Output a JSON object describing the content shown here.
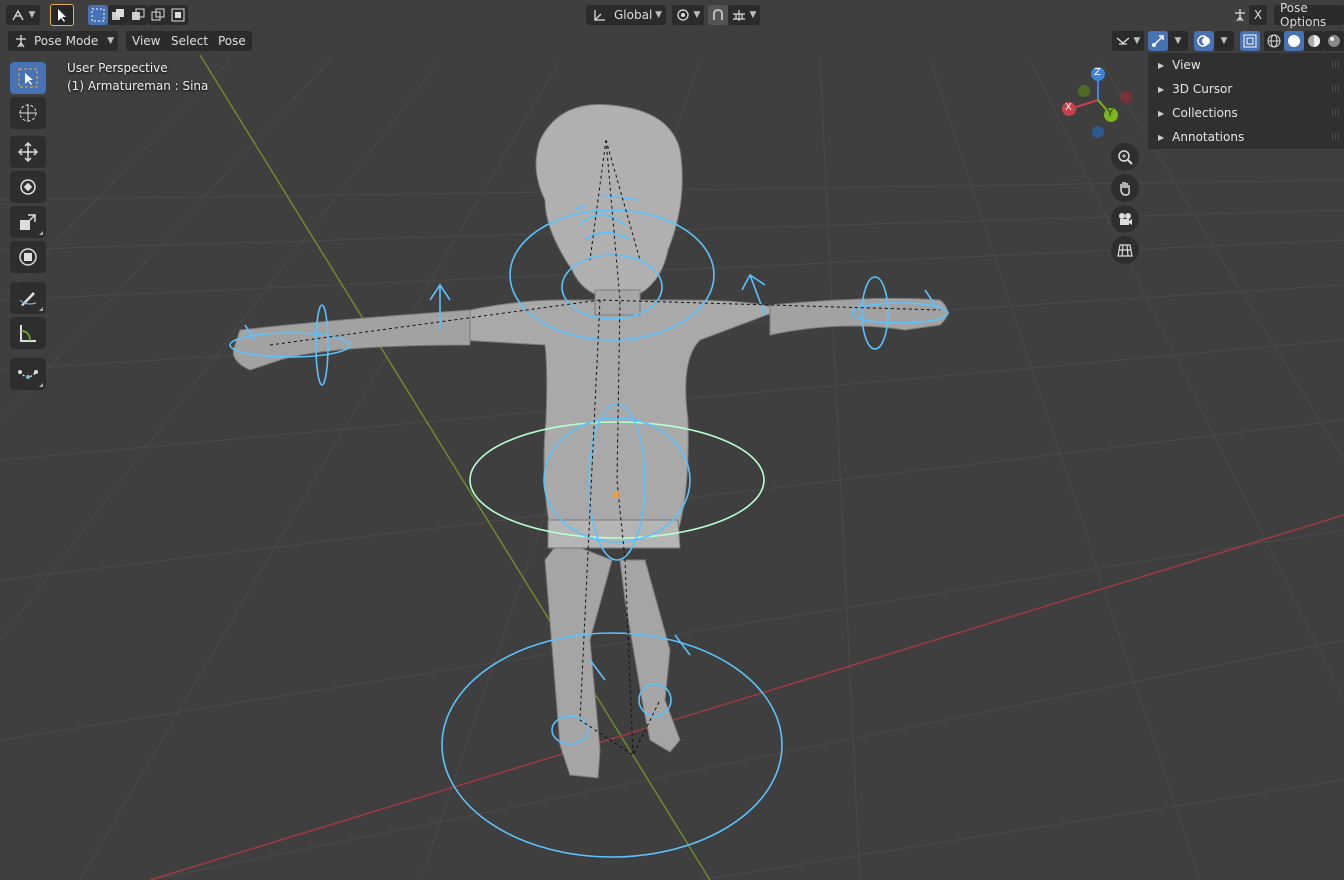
{
  "header": {
    "transform_orientation": "Global",
    "pose_options_label": "Pose Options",
    "close_label": "X"
  },
  "menubar": {
    "mode": "Pose Mode",
    "items": [
      "View",
      "Select",
      "Pose"
    ]
  },
  "viewport": {
    "perspective_label": "User Perspective",
    "object_label": "(1) Armatureman : Sina"
  },
  "gizmo": {
    "x": "X",
    "y": "Y",
    "z": "Z"
  },
  "sidebar": {
    "panels": [
      "View",
      "3D Cursor",
      "Collections",
      "Annotations"
    ]
  },
  "icons": {
    "select_box": "select-box-icon",
    "cursor": "cursor-icon",
    "move": "move-icon",
    "rotate": "rotate-icon",
    "scale": "scale-icon",
    "transform": "transform-icon",
    "annotate": "annotate-icon",
    "measure": "measure-icon",
    "relax": "relax-icon"
  },
  "colors": {
    "accent": "#4772b3",
    "bone": "#59c3ff",
    "x_axis": "#c8414c",
    "y_axis": "#7bb61e",
    "z_axis": "#3d85d8"
  }
}
